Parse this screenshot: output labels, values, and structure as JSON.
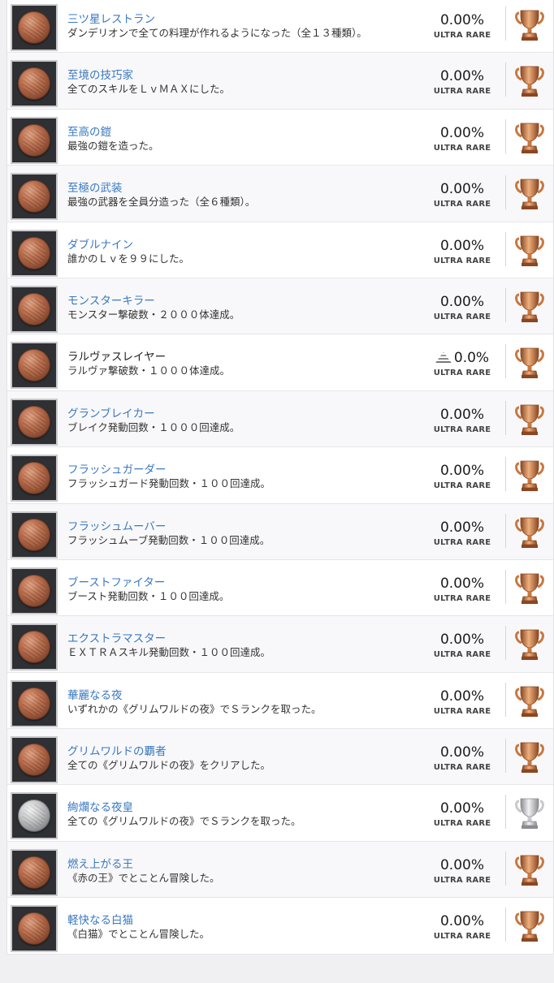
{
  "colors": {
    "bronze": "#c06e3e",
    "silver": "#b8b8bc",
    "link": "#3a78c0"
  },
  "trophies": [
    {
      "title": "三ツ星レストラン",
      "description": "ダンデリオンで全ての料理が作れるようになった（全１３種類）。",
      "percent": "0.00%",
      "rarity": "ULTRA RARE",
      "grade": "bronze",
      "link": true
    },
    {
      "title": "至境の技巧家",
      "description": "全てのスキルをＬｖＭＡＸにした。",
      "percent": "0.00%",
      "rarity": "ULTRA RARE",
      "grade": "bronze",
      "link": true
    },
    {
      "title": "至高の鎧",
      "description": "最強の鎧を造った。",
      "percent": "0.00%",
      "rarity": "ULTRA RARE",
      "grade": "bronze",
      "link": true
    },
    {
      "title": "至極の武装",
      "description": "最強の武器を全員分造った（全６種類）。",
      "percent": "0.00%",
      "rarity": "ULTRA RARE",
      "grade": "bronze",
      "link": true
    },
    {
      "title": "ダブルナイン",
      "description": "誰かのＬｖを９９にした。",
      "percent": "0.00%",
      "rarity": "ULTRA RARE",
      "grade": "bronze",
      "link": true
    },
    {
      "title": "モンスターキラー",
      "description": "モンスター撃破数・２０００体達成。",
      "percent": "0.00%",
      "rarity": "ULTRA RARE",
      "grade": "bronze",
      "link": true
    },
    {
      "title": "ラルヴァスレイヤー",
      "description": "ラルヴァ撃破数・１０００体達成。",
      "percent": "0.0%",
      "rarity": "ULTRA RARE",
      "grade": "bronze",
      "link": false,
      "stack_icon": true
    },
    {
      "title": "グランブレイカー",
      "description": "ブレイク発動回数・１０００回達成。",
      "percent": "0.00%",
      "rarity": "ULTRA RARE",
      "grade": "bronze",
      "link": true
    },
    {
      "title": "フラッシュガーダー",
      "description": "フラッシュガード発動回数・１００回達成。",
      "percent": "0.00%",
      "rarity": "ULTRA RARE",
      "grade": "bronze",
      "link": true
    },
    {
      "title": "フラッシュムーバー",
      "description": "フラッシュムーブ発動回数・１００回達成。",
      "percent": "0.00%",
      "rarity": "ULTRA RARE",
      "grade": "bronze",
      "link": true
    },
    {
      "title": "ブーストファイター",
      "description": "ブースト発動回数・１００回達成。",
      "percent": "0.00%",
      "rarity": "ULTRA RARE",
      "grade": "bronze",
      "link": true
    },
    {
      "title": "エクストラマスター",
      "description": "ＥＸＴＲＡスキル発動回数・１００回達成。",
      "percent": "0.00%",
      "rarity": "ULTRA RARE",
      "grade": "bronze",
      "link": true
    },
    {
      "title": "華麗なる夜",
      "description": "いずれかの《グリムワルドの夜》でＳランクを取った。",
      "percent": "0.00%",
      "rarity": "ULTRA RARE",
      "grade": "bronze",
      "link": true
    },
    {
      "title": "グリムワルドの覇者",
      "description": "全ての《グリムワルドの夜》をクリアした。",
      "percent": "0.00%",
      "rarity": "ULTRA RARE",
      "grade": "bronze",
      "link": true
    },
    {
      "title": "絢爛なる夜皇",
      "description": "全ての《グリムワルドの夜》でＳランクを取った。",
      "percent": "0.00%",
      "rarity": "ULTRA RARE",
      "grade": "silver",
      "link": true
    },
    {
      "title": "燃え上がる王",
      "description": "《赤の王》でとことん冒険した。",
      "percent": "0.00%",
      "rarity": "ULTRA RARE",
      "grade": "bronze",
      "link": true
    },
    {
      "title": "軽快なる白猫",
      "description": "《白猫》でとことん冒険した。",
      "percent": "0.00%",
      "rarity": "ULTRA RARE",
      "grade": "bronze",
      "link": true
    }
  ]
}
